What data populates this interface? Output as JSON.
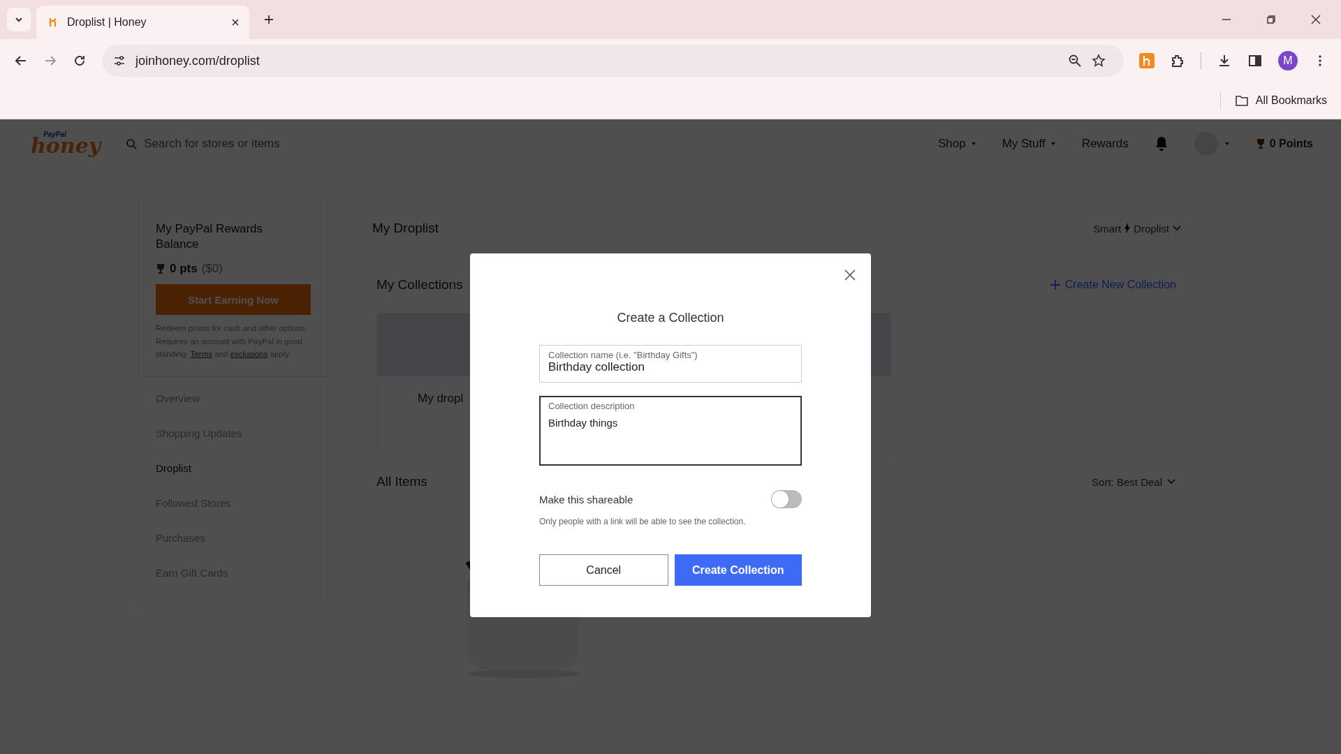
{
  "browser": {
    "tabs": [
      {
        "title": "Droplist | Honey",
        "selected": true
      }
    ],
    "url": "joinhoney.com/droplist",
    "profile_initial": "M",
    "bookmarks": [
      "All Bookmarks"
    ]
  },
  "header": {
    "logo_small": "PayPal",
    "logo": "honey",
    "search": {
      "placeholder": "Search for stores or items"
    },
    "nav": [
      {
        "label": "Shop",
        "dropdown": true
      },
      {
        "label": "My Stuff",
        "dropdown": true
      },
      {
        "label": "Rewards",
        "dropdown": false
      }
    ],
    "points": "0 Points"
  },
  "sidebar": {
    "title": "My PayPal Rewards Balance",
    "points": "0 pts",
    "cash": "($0)",
    "button": "Start Earning Now",
    "note": [
      {
        "text": "Redeem points for cash and other options. Requires an account with PayPal in good standing. ",
        "kind": "text"
      },
      {
        "text": "Terms",
        "kind": "link"
      },
      {
        "text": " and ",
        "kind": "text"
      },
      {
        "text": "exclusions",
        "kind": "link"
      },
      {
        "text": " apply.",
        "kind": "text"
      }
    ],
    "items": [
      {
        "label": "Overview",
        "selected": false
      },
      {
        "label": "Shopping Updates",
        "selected": false
      },
      {
        "label": "Droplist",
        "selected": true
      },
      {
        "label": "Followed Stores",
        "selected": false
      },
      {
        "label": "Purchases",
        "selected": false
      },
      {
        "label": "Earn Gift Cards",
        "selected": false
      }
    ]
  },
  "main": {
    "title": "My Droplist",
    "mode": {
      "before": "Smart",
      "after": "Droplist"
    },
    "collections_title": "My Collections",
    "create_link": "Create New Collection",
    "collections": [
      {
        "name": "My dropl"
      }
    ],
    "all_items_title": "All Items",
    "sort": "Sort: Best Deal"
  },
  "modal": {
    "title": "Create a Collection",
    "name_field": {
      "label": "Collection name (i.e. \"Birthday Gifts\")",
      "value": "Birthday collection"
    },
    "description_field": {
      "label": "Collection description",
      "value": "Birthday things",
      "focused": true
    },
    "shareable": {
      "label": "Make this shareable",
      "on": false,
      "hint": "Only people with a link will be able to see the collection."
    },
    "buttons": [
      {
        "label": "Cancel",
        "kind": "secondary"
      },
      {
        "label": "Create Collection",
        "kind": "primary"
      }
    ]
  }
}
